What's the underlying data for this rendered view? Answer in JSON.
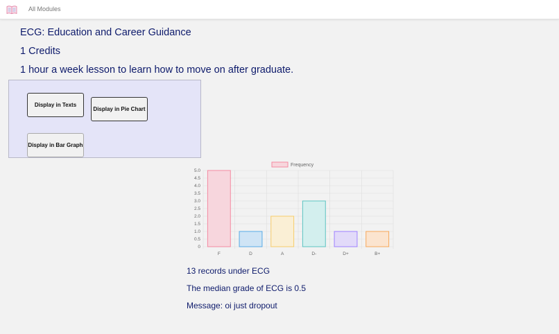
{
  "nav": {
    "logo_icon": "book-icon",
    "link_label": "All Modules"
  },
  "module": {
    "title": "ECG: Education and Career Guidance",
    "credits": "1 Credits",
    "description": "1 hour a week lesson to learn how to move on after graduate."
  },
  "buttons": {
    "texts": "Display in Texts",
    "pie": "Display in Pie Chart",
    "bar": "Display in Bar Graph"
  },
  "chart_data": {
    "type": "bar",
    "categories": [
      "F",
      "D",
      "A",
      "D-",
      "D+",
      "B+"
    ],
    "series": [
      {
        "name": "Frequency",
        "values": [
          5,
          1,
          2,
          3,
          1,
          1
        ]
      }
    ],
    "ylim": [
      0,
      5
    ],
    "yticks": [
      "0",
      "0.5",
      "1.0",
      "1.5",
      "2.0",
      "2.5",
      "3.0",
      "3.5",
      "4.0",
      "4.5",
      "5.0"
    ],
    "legend_position": "top-center",
    "grid": true,
    "bar_colors": [
      "#f7d6dd",
      "#cfe4f5",
      "#faefd5",
      "#d3efee",
      "#e2daf9",
      "#fbe4cf"
    ],
    "bar_borders": [
      "#f48aa1",
      "#58abe6",
      "#f7cd6b",
      "#5cc4c2",
      "#9f80ff",
      "#f7a85a"
    ]
  },
  "summary": {
    "records": "13 records under ECG",
    "median": "The median grade of ECG is 0.5",
    "message": "Message: oi just dropout"
  }
}
